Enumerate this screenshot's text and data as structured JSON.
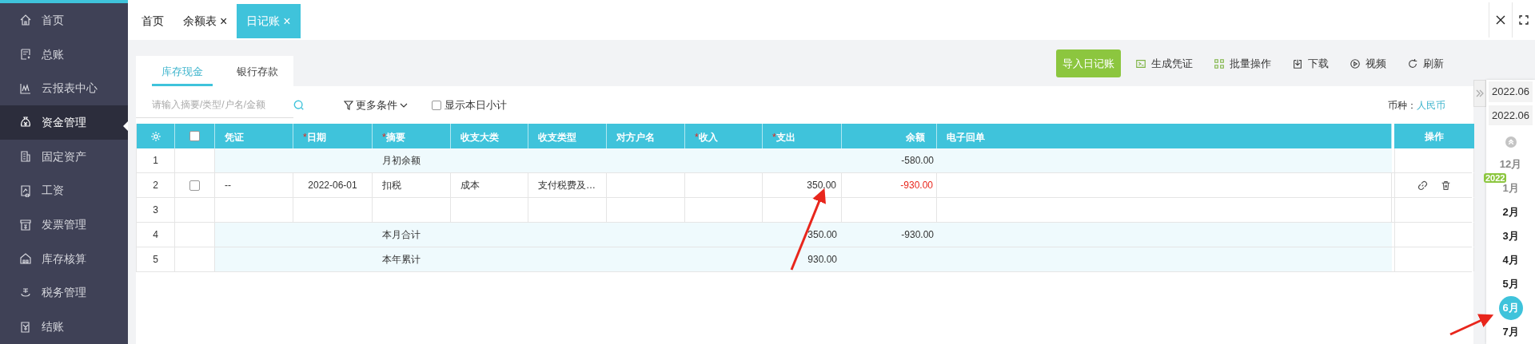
{
  "sidebar": {
    "items": [
      {
        "label": "首页",
        "selected": false
      },
      {
        "label": "总账",
        "selected": false
      },
      {
        "label": "云报表中心",
        "selected": false
      },
      {
        "label": "资金管理",
        "selected": true
      },
      {
        "label": "固定资产",
        "selected": false
      },
      {
        "label": "工资",
        "selected": false
      },
      {
        "label": "发票管理",
        "selected": false
      },
      {
        "label": "库存核算",
        "selected": false
      },
      {
        "label": "税务管理",
        "selected": false
      },
      {
        "label": "结账",
        "selected": false
      }
    ]
  },
  "tabs": [
    {
      "label": "首页",
      "selected": false
    },
    {
      "label": "余额表",
      "close": "×",
      "selected": false
    },
    {
      "label": "日记账",
      "close": "×",
      "selected": true
    }
  ],
  "subtabs": [
    {
      "label": "库存现金",
      "selected": true
    },
    {
      "label": "银行存款",
      "selected": false
    }
  ],
  "toolbar": {
    "primary_button": "导入日记账",
    "actions": [
      "生成凭证",
      "批量操作",
      "下载",
      "视频",
      "刷新"
    ]
  },
  "filters": {
    "search": {
      "placeholder": "请输入摘要/类型/户名/金额"
    },
    "more": "更多条件",
    "daily_subtotal": {
      "label": "显示本日小计",
      "checked": false
    },
    "currency_label": "币种：",
    "currency": "人民币"
  },
  "table": {
    "select_all_checked": false,
    "columns": [
      {
        "label": "凭证"
      },
      {
        "label": "日期",
        "required_mark": "*"
      },
      {
        "label": "摘要",
        "required_mark": "*"
      },
      {
        "label": "收支大类"
      },
      {
        "label": "收支类型"
      },
      {
        "label": "对方户名"
      },
      {
        "label": "收入",
        "required_mark": "*"
      },
      {
        "label": "支出",
        "required_mark": "*"
      },
      {
        "label": "余额"
      },
      {
        "label": "电子回单"
      }
    ],
    "actions_header": "操作",
    "rows": [
      {
        "no": "1",
        "kind": "summary",
        "summary": "月初余额",
        "balance": "-580.00",
        "alert": false
      },
      {
        "no": "2",
        "kind": "entry",
        "checked": false,
        "voucher": "--",
        "date": "2022-06-01",
        "summary": "扣税",
        "category": "成本",
        "type": "支付税费及…",
        "expense": "350.00",
        "balance": "-930.00",
        "alert": true,
        "actions": true
      },
      {
        "no": "3",
        "kind": "blank"
      },
      {
        "no": "4",
        "kind": "summary",
        "summary": "本月合计",
        "expense": "350.00",
        "balance": "-930.00",
        "alert": false
      },
      {
        "no": "5",
        "kind": "summary",
        "summary": "本年累计",
        "expense": "930.00"
      }
    ]
  },
  "period": {
    "from": "2022.06",
    "to": "2022.06"
  },
  "calendar": {
    "year": "2022",
    "months": [
      {
        "label": "12月",
        "selected": false,
        "dimmed": true
      },
      {
        "label": "1月",
        "selected": false,
        "dimmed": true
      },
      {
        "label": "2月",
        "selected": false,
        "dimmed": false
      },
      {
        "label": "3月",
        "selected": false,
        "dimmed": false
      },
      {
        "label": "4月",
        "selected": false,
        "dimmed": false
      },
      {
        "label": "5月",
        "selected": false,
        "dimmed": false
      },
      {
        "label": "6月",
        "selected": true,
        "dimmed": false
      },
      {
        "label": "7月",
        "selected": false,
        "dimmed": false
      }
    ]
  }
}
